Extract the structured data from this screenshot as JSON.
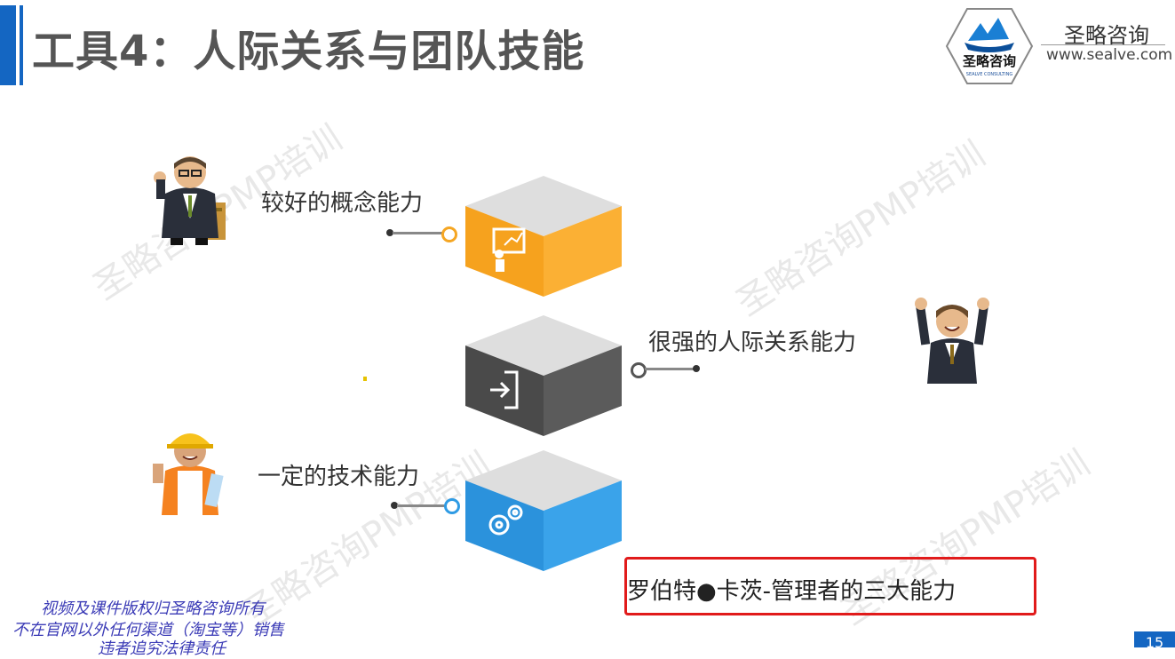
{
  "slide": {
    "title": "工具4：人际关系与团队技能",
    "brand": {
      "logo_text": "圣略咨询",
      "logo_subtext": "SEALVE CONSULTING",
      "name": "圣略咨询",
      "url": "www.sealve.com"
    },
    "watermark": "圣略咨询PMP培训",
    "items": [
      {
        "label": "较好的概念能力",
        "icon": "presentation-icon",
        "color": "#f5a623"
      },
      {
        "label": "很强的人际关系能力",
        "icon": "login-icon",
        "color": "#4a4a4a"
      },
      {
        "label": "一定的技术能力",
        "icon": "gears-icon",
        "color": "#2f9be4"
      }
    ],
    "caption": "罗伯特●卡茨-管理者的三大能力",
    "copyright": [
      "视频及课件版权归圣略咨询所有",
      "不在官网以外任何渠道（淘宝等）销售",
      "违者追究法律责任"
    ],
    "page_number": "15"
  }
}
